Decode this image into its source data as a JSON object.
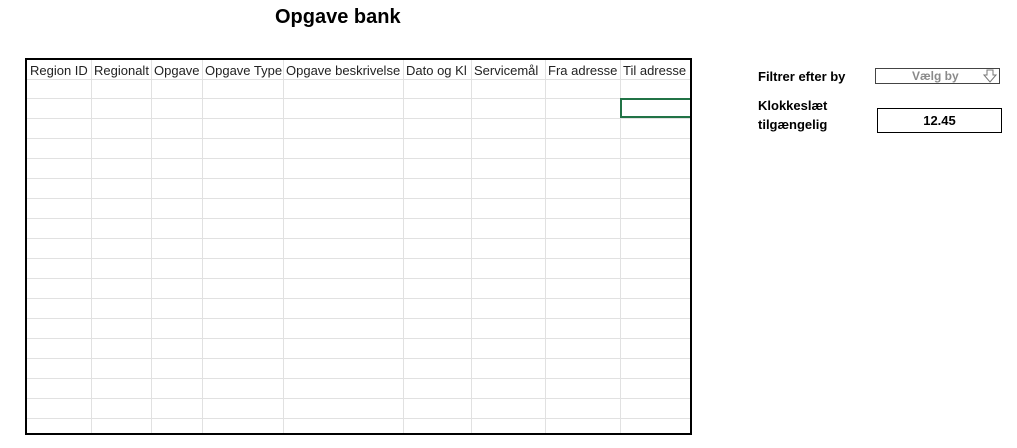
{
  "title": "Opgave bank",
  "table": {
    "headers": [
      "Region ID",
      "Regionalt",
      "Opgave",
      "Opgave Type",
      "Opgave beskrivelse",
      "Dato og Kl",
      "Servicemål",
      "Fra adresse",
      "Til adresse"
    ]
  },
  "filter": {
    "label": "Filtrer efter by",
    "dropdown_value": "Vælg by",
    "icon": "down-arrow-icon"
  },
  "time": {
    "label_line1": "Klokkeslæt",
    "label_line2": "tilgængelig",
    "value": "12.45"
  },
  "colors": {
    "selection": "#217346",
    "gridline": "#e1e1e1"
  }
}
